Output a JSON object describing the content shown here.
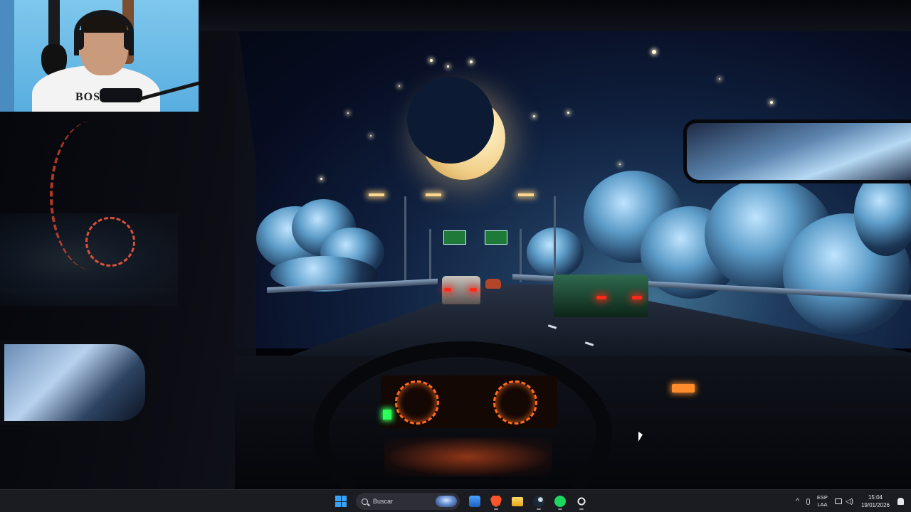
{
  "taskbar": {
    "search_label": "Buscar",
    "pinned_apps": [
      {
        "name": "start",
        "icon": "windows-logo-icon"
      },
      {
        "name": "weather-widget",
        "icon": "weather-app-icon"
      },
      {
        "name": "brave",
        "icon": "brave-browser-icon"
      },
      {
        "name": "file-explorer",
        "icon": "folder-icon"
      },
      {
        "name": "steam",
        "icon": "steam-icon"
      },
      {
        "name": "spotify",
        "icon": "spotify-icon"
      },
      {
        "name": "obs",
        "icon": "obs-icon"
      }
    ],
    "tray": {
      "language_top": "ESP",
      "language_bottom": "LAA",
      "time": "15:04",
      "date": "19/01/2026"
    }
  },
  "webcam": {
    "shirt_text": "BOS"
  },
  "colors": {
    "taskbar_bg": "#1b1c22",
    "accent_windows": "#3aa2f5",
    "spotify_green": "#1ed760",
    "brave_orange": "#fb542b",
    "dash_orange": "#ff6a1f"
  }
}
